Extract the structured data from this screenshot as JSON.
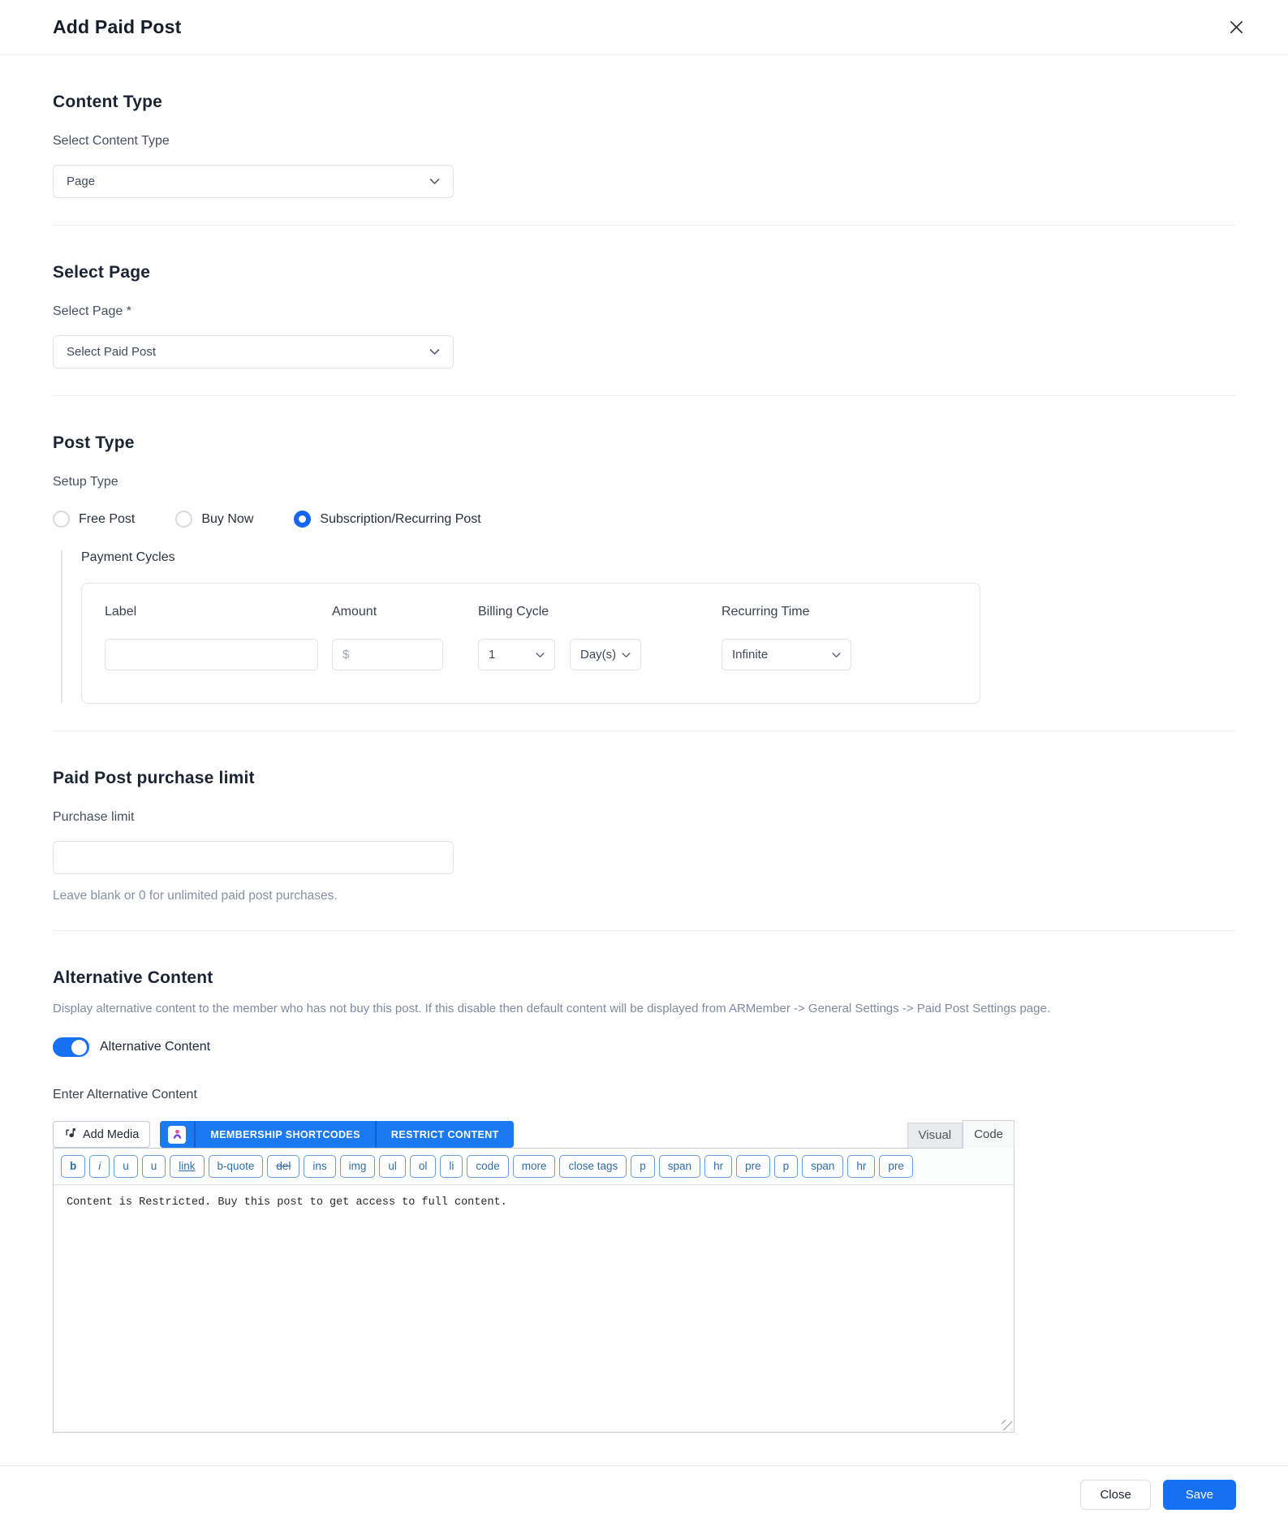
{
  "modal": {
    "title": "Add Paid Post"
  },
  "sections": {
    "content_type": {
      "heading": "Content Type",
      "label": "Select Content Type",
      "select_value": "Page"
    },
    "select_page": {
      "heading": "Select Page",
      "label": "Select Page *",
      "select_value": "Select Paid Post"
    },
    "post_type": {
      "heading": "Post Type",
      "label": "Setup Type",
      "options": [
        {
          "label": "Free Post",
          "selected": false
        },
        {
          "label": "Buy Now",
          "selected": false
        },
        {
          "label": "Subscription/Recurring Post",
          "selected": true
        }
      ],
      "payment_cycles": {
        "heading": "Payment Cycles",
        "columns": [
          "Label",
          "Amount",
          "Billing Cycle",
          "Recurring Time"
        ],
        "label_value": "",
        "amount_placeholder": "$",
        "billing_cycle_value": "1",
        "billing_unit_value": "Day(s)",
        "recurring_time_value": "Infinite"
      }
    },
    "purchase_limit": {
      "heading": "Paid Post purchase limit",
      "label": "Purchase limit",
      "value": "",
      "hint": "Leave blank or 0 for unlimited paid post purchases."
    },
    "alternative_content": {
      "heading": "Alternative Content",
      "description": "Display alternative content to the member who has not buy this post. If this disable then default content will be displayed from ARMember -> General Settings -> Paid Post Settings page.",
      "toggle_label": "Alternative Content",
      "toggle_on": true,
      "editor_label": "Enter Alternative Content"
    }
  },
  "editor": {
    "add_media_label": "Add Media",
    "membership_shortcodes_label": "MEMBERSHIP SHORTCODES",
    "restrict_content_label": "RESTRICT CONTENT",
    "tabs": [
      {
        "label": "Visual",
        "active": false
      },
      {
        "label": "Code",
        "active": true
      }
    ],
    "quicktags": [
      "b",
      "i",
      "u",
      "u",
      "link",
      "b-quote",
      "del",
      "ins",
      "img",
      "ul",
      "ol",
      "li",
      "code",
      "more",
      "close tags",
      "p",
      "span",
      "hr",
      "pre",
      "p",
      "span",
      "hr",
      "pre"
    ],
    "content": "Content is Restricted. Buy this post to get access to full content."
  },
  "footer": {
    "close_label": "Close",
    "save_label": "Save"
  },
  "colors": {
    "accent": "#1670f2",
    "editor_button_blue": "#1b7af2",
    "quicktag_blue": "#2f6da8"
  }
}
